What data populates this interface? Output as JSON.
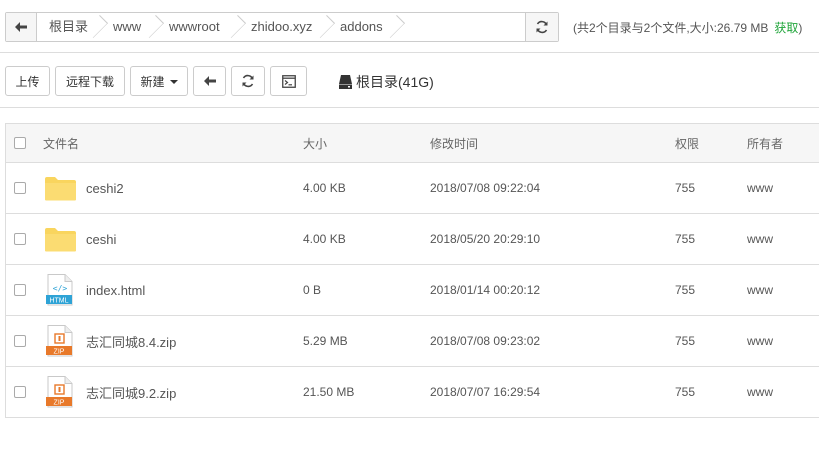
{
  "path": {
    "crumbs": [
      "根目录",
      "www",
      "wwwroot",
      "zhidoo.xyz",
      "addons"
    ]
  },
  "summary": {
    "text": "(共2个目录与2个文件,大小:26.79 MB",
    "fetch_label": "获取",
    "close_paren": ")"
  },
  "toolbar": {
    "upload_label": "上传",
    "remote_download_label": "远程下载",
    "new_label": "新建",
    "disk_label": "根目录(41G)"
  },
  "table": {
    "headers": {
      "name": "文件名",
      "size": "大小",
      "mtime": "修改时间",
      "perm": "权限",
      "owner": "所有者"
    },
    "rows": [
      {
        "type": "folder",
        "name": "ceshi2",
        "size": "4.00 KB",
        "mtime": "2018/07/08 09:22:04",
        "perm": "755",
        "owner": "www"
      },
      {
        "type": "folder",
        "name": "ceshi",
        "size": "4.00 KB",
        "mtime": "2018/05/20 20:29:10",
        "perm": "755",
        "owner": "www"
      },
      {
        "type": "html",
        "name": "index.html",
        "size": "0 B",
        "mtime": "2018/01/14 00:20:12",
        "perm": "755",
        "owner": "www"
      },
      {
        "type": "zip",
        "name": "志汇同城8.4.zip",
        "size": "5.29 MB",
        "mtime": "2018/07/08 09:23:02",
        "perm": "755",
        "owner": "www"
      },
      {
        "type": "zip",
        "name": "志汇同城9.2.zip",
        "size": "21.50 MB",
        "mtime": "2018/07/07 16:29:54",
        "perm": "755",
        "owner": "www"
      }
    ]
  },
  "icons": {
    "html_badge": "HTML",
    "zip_badge": "ZIP",
    "html_symbol": "</>"
  },
  "colors": {
    "accent_green": "#20a53a",
    "folder_yellow": "#f9d55e",
    "html_blue": "#2ea3d6",
    "zip_orange": "#e8792a"
  }
}
